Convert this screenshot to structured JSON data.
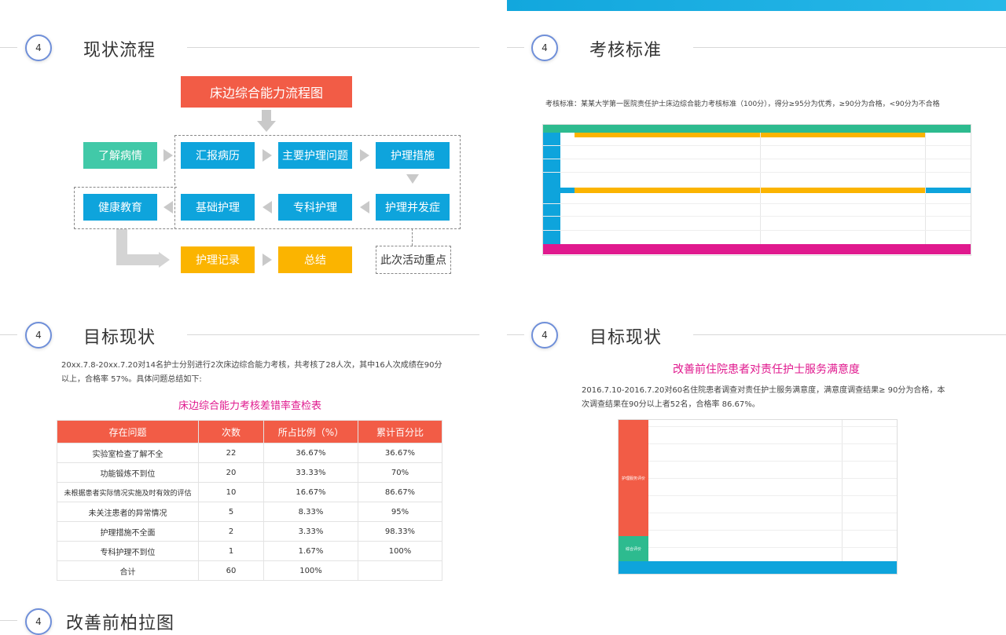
{
  "sections": {
    "s1": {
      "num": "4",
      "title": "现状流程"
    },
    "s2": {
      "num": "4",
      "title": "考核标准"
    },
    "s3": {
      "num": "4",
      "title": "目标现状"
    },
    "s4": {
      "num": "4",
      "title": "目标现状"
    },
    "s5": {
      "num": "4",
      "title": "改善前柏拉图"
    }
  },
  "flow": {
    "title": "床边综合能力流程图",
    "understand": "了解病情",
    "report": "汇报病历",
    "main_problem": "主要护理问题",
    "measures": "护理措施",
    "health_edu": "健康教育",
    "basic_care": "基础护理",
    "special_care": "专科护理",
    "complication": "护理并发症",
    "record": "护理记录",
    "summary": "总结",
    "focus": "此次活动重点"
  },
  "standard": {
    "caption": "考核标准：某某大学第一医院责任护士床边综合能力考核标准（100分），得分≥95分为优秀，≥90分为合格，<90分为不合格"
  },
  "target": {
    "para": "20xx.7.8-20xx.7.20对14名护士分别进行2次床边综合能力考核，共考核了28人次，其中16人次成绩在90分以上，合格率 57%。具体问题总结如下:",
    "table_title": "床边综合能力考核差错率查检表",
    "headers": [
      "存在问题",
      "次数",
      "所占比例（%）",
      "累计百分比"
    ],
    "rows": [
      [
        "实验室检查了解不全",
        "22",
        "36.67%",
        "36.67%"
      ],
      [
        "功能锻炼不到位",
        "20",
        "33.33%",
        "70%"
      ],
      [
        "未根据患者实际情况实施及时有效的评估",
        "10",
        "16.67%",
        "86.67%"
      ],
      [
        "未关注患者的异常情况",
        "5",
        "8.33%",
        "95%"
      ],
      [
        "护理措施不全面",
        "2",
        "3.33%",
        "98.33%"
      ],
      [
        "专科护理不到位",
        "1",
        "1.67%",
        "100%"
      ],
      [
        "合计",
        "60",
        "100%",
        ""
      ]
    ]
  },
  "satisfaction": {
    "title": "改善前住院患者对责任护士服务满意度",
    "para": "2016.7.10-2016.7.20对60名住院患者调查对责任护士服务满意度，满意度调查结果≥ 90分为合格，本次调查结果在90分以上者52名，合格率 86.67%。",
    "left_label_1": "护理服务评价",
    "left_label_2": "综合评价"
  },
  "colors": {
    "blue": "#0ea4dc",
    "orange": "#f25c46",
    "teal": "#41c9a8",
    "yellow": "#fbb400",
    "pink": "#e0198e",
    "green": "#2dbb8f"
  }
}
